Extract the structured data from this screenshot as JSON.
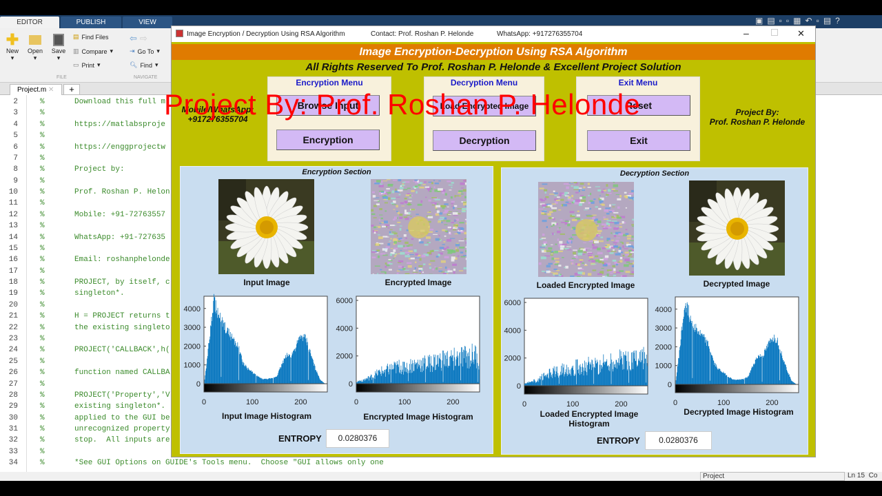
{
  "ribbon": {
    "tabs": [
      "EDITOR",
      "PUBLISH",
      "VIEW"
    ],
    "file": {
      "new": "New",
      "open": "Open",
      "save": "Save",
      "find_files": "Find Files",
      "compare": "Compare",
      "print": "Print",
      "group": "FILE"
    },
    "navigate": {
      "go_to": "Go To",
      "find": "Find",
      "group": "NAVIGATE"
    }
  },
  "editor": {
    "tab": "Project.m",
    "lines": [
      {
        "n": "2",
        "t": "Download this full m"
      },
      {
        "n": "3",
        "t": ""
      },
      {
        "n": "4",
        "t": "https://matlabsproje"
      },
      {
        "n": "5",
        "t": ""
      },
      {
        "n": "6",
        "t": "https://enggprojectw"
      },
      {
        "n": "7",
        "t": ""
      },
      {
        "n": "8",
        "t": "Project by:"
      },
      {
        "n": "9",
        "t": ""
      },
      {
        "n": "10",
        "t": "Prof. Roshan P. Helon"
      },
      {
        "n": "11",
        "t": ""
      },
      {
        "n": "12",
        "t": "Mobile: +91-72763557"
      },
      {
        "n": "13",
        "t": ""
      },
      {
        "n": "14",
        "t": "WhatsApp: +91-727635"
      },
      {
        "n": "15",
        "t": ""
      },
      {
        "n": "16",
        "t": "Email: roshanphelonde"
      },
      {
        "n": "17",
        "t": ""
      },
      {
        "n": "18",
        "t": "PROJECT, by itself, c"
      },
      {
        "n": "19",
        "t": "singleton*."
      },
      {
        "n": "20",
        "t": ""
      },
      {
        "n": "21",
        "t": "H = PROJECT returns t"
      },
      {
        "n": "22",
        "t": "the existing singleto"
      },
      {
        "n": "23",
        "t": ""
      },
      {
        "n": "24",
        "t": "PROJECT('CALLBACK',h("
      },
      {
        "n": "25",
        "t": ""
      },
      {
        "n": "26",
        "t": "function named CALLBA"
      },
      {
        "n": "27",
        "t": ""
      },
      {
        "n": "28",
        "t": "PROJECT('Property','V"
      },
      {
        "n": "29",
        "t": "existing singleton*."
      },
      {
        "n": "30",
        "t": "applied to the GUI be"
      },
      {
        "n": "31",
        "t": "unrecognized property"
      },
      {
        "n": "32",
        "t": "stop.  All inputs are"
      },
      {
        "n": "33",
        "t": ""
      },
      {
        "n": "34",
        "t": "*See GUI Options on GUIDE's Tools menu.  Choose \"GUI allows only one"
      }
    ]
  },
  "status": {
    "file": "Project",
    "ln_label": "Ln",
    "ln": "15",
    "col": "Co"
  },
  "figure": {
    "title": "Image Encryption / Decryption Using RSA Algorithm",
    "contact": "Contact: Prof. Roshan P. Helonde",
    "whatsapp": "WhatsApp: +917276355704",
    "banner": "Image Encryption-Decryption Using RSA Algorithm",
    "rights": "All Rights Reserved To Prof. Roshan P. Helonde & Excellent Project Solution",
    "mobile_label": "Mobile/WhatsApp:",
    "mobile": "+917276355704",
    "project_by": "Project By:",
    "author": "Prof. Roshan P. Helonde",
    "enc_menu": {
      "title": "Encryption Menu",
      "browse": "Browse Input",
      "encrypt": "Encryption"
    },
    "dec_menu": {
      "title": "Decryption Menu",
      "load": "Load Encrypted Image",
      "decrypt": "Decryption"
    },
    "exit_menu": {
      "title": "Exit Menu",
      "reset": "Reset",
      "exit": "Exit"
    },
    "enc_section": {
      "title": "Encryption Section",
      "input_caption": "Input Image",
      "encrypted_caption": "Encrypted Image",
      "input_hist": "Input Image Histogram",
      "enc_hist": "Encrypted Image Histogram",
      "entropy_label": "ENTROPY",
      "entropy": "0.0280376"
    },
    "dec_section": {
      "title": "Decryption Section",
      "loaded_caption": "Loaded Encrypted Image",
      "decrypted_caption": "Decrypted Image",
      "loaded_hist": "Loaded Encrypted Image Histogram",
      "dec_hist": "Decrypted Image Histogram",
      "entropy_label": "ENTROPY",
      "entropy": "0.0280376"
    }
  },
  "watermark": "Project By: Prof. Roshan P. Helonde",
  "colors": {
    "banner": "#e07b00",
    "figure_bg": "#bfc000",
    "section_bg": "#c9ddf0",
    "button": "#d3b9f5",
    "bars": "#0072bd",
    "watermark": "#ff0000"
  },
  "chart_data": [
    {
      "type": "bar",
      "id": "input",
      "bin_width": 10,
      "x_start": 0,
      "xlim": [
        0,
        255
      ],
      "ylim": [
        0,
        4650
      ],
      "xticks": [
        0,
        100,
        200
      ],
      "yticks": [
        0,
        1000,
        2000,
        3000,
        4000
      ],
      "values": [
        0,
        2200,
        4400,
        3600,
        3100,
        2700,
        2400,
        2000,
        1100,
        800,
        600,
        400,
        250,
        250,
        280,
        400,
        1000,
        1500,
        1500,
        2000,
        2500,
        2400,
        1600,
        800,
        200,
        0
      ]
    },
    {
      "type": "bar",
      "id": "encrypted",
      "bin_width": 10,
      "x_start": 0,
      "xlim": [
        0,
        255
      ],
      "ylim": [
        0,
        6300
      ],
      "xticks": [
        0,
        100,
        200
      ],
      "yticks": [
        0,
        2000,
        4000,
        6000
      ],
      "values": [
        150,
        250,
        350,
        500,
        700,
        900,
        1000,
        1100,
        1200,
        1300,
        1300,
        1400,
        1400,
        1500,
        1500,
        1500,
        1600,
        1700,
        1800,
        1800,
        1900,
        1900,
        2000,
        2000,
        2100,
        2100
      ]
    },
    {
      "type": "bar",
      "id": "loaded",
      "bin_width": 10,
      "x_start": 0,
      "xlim": [
        0,
        255
      ],
      "ylim": [
        0,
        6300
      ],
      "xticks": [
        0,
        100,
        200
      ],
      "yticks": [
        0,
        2000,
        4000,
        6000
      ],
      "values": [
        150,
        250,
        350,
        500,
        700,
        900,
        1000,
        1100,
        1200,
        1300,
        1300,
        1400,
        1400,
        1500,
        1500,
        1500,
        1600,
        1700,
        1800,
        1800,
        1900,
        1900,
        2000,
        2000,
        2100,
        2100
      ]
    },
    {
      "type": "bar",
      "id": "decrypted",
      "bin_width": 10,
      "x_start": 0,
      "xlim": [
        0,
        255
      ],
      "ylim": [
        0,
        4650
      ],
      "xticks": [
        0,
        100,
        200
      ],
      "yticks": [
        0,
        1000,
        2000,
        3000,
        4000
      ],
      "values": [
        0,
        2200,
        4400,
        3600,
        3100,
        2700,
        2400,
        2000,
        1100,
        800,
        600,
        400,
        250,
        250,
        280,
        400,
        1000,
        1500,
        1500,
        2000,
        2500,
        2400,
        1600,
        800,
        200,
        0
      ]
    }
  ]
}
